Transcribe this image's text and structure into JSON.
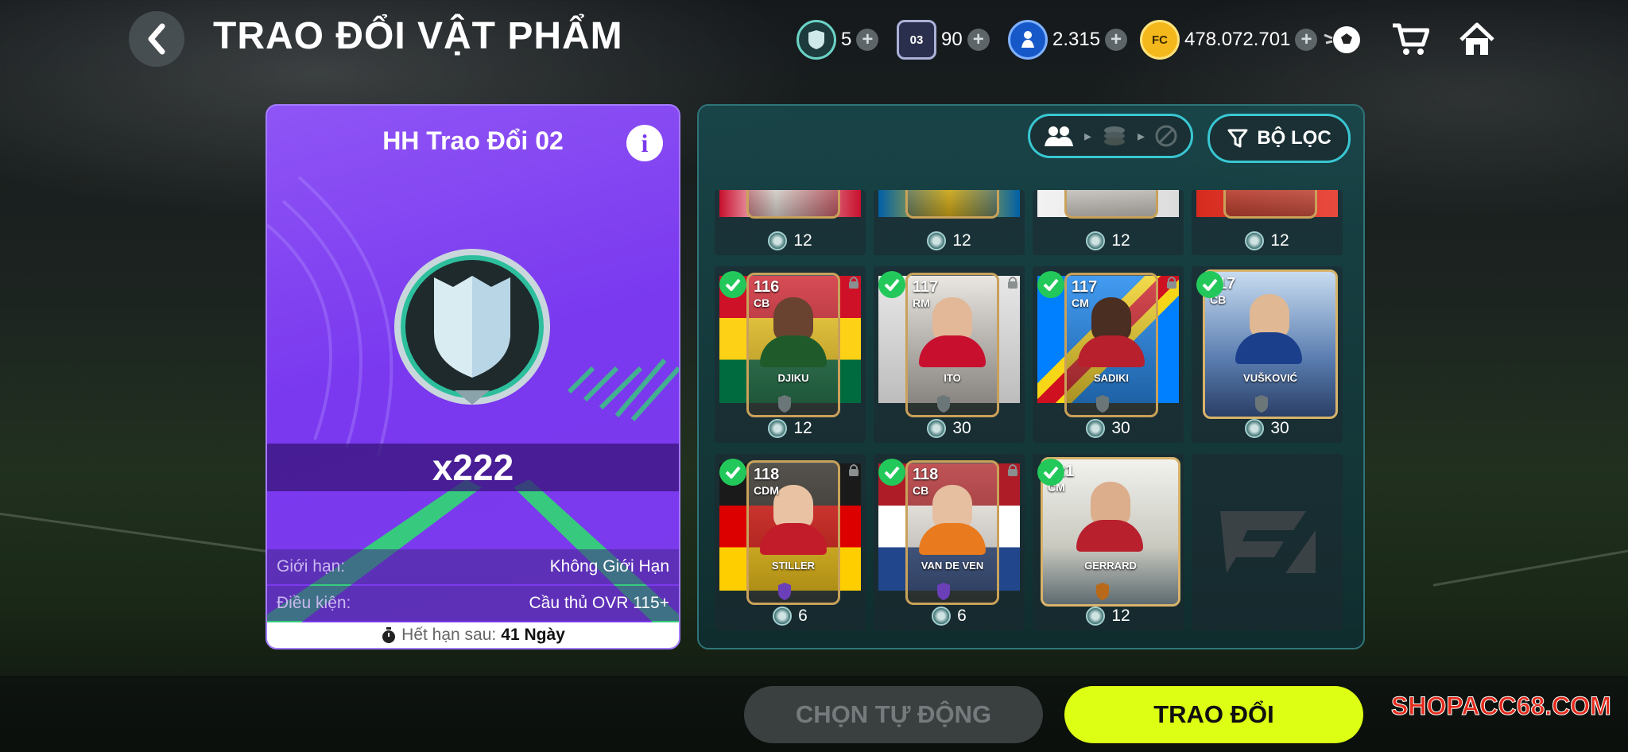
{
  "header": {
    "title": "TRAO ĐỔI VẬT PHẨM",
    "currencies": [
      {
        "icon": "shield-token-icon",
        "value": "5"
      },
      {
        "icon": "pack-03-icon",
        "value": "90",
        "badge": "03"
      },
      {
        "icon": "player-token-icon",
        "value": "2.315"
      },
      {
        "icon": "fc-coin-icon",
        "value": "478.072.701"
      }
    ]
  },
  "item_card": {
    "title": "HH Trao Đổi 02",
    "quantity": "x222",
    "limit_label": "Giới hạn:",
    "limit_value": "Không Giới Hạn",
    "condition_label": "Điều kiện:",
    "condition_value": "Cầu thủ OVR 115+",
    "expire_label": "Hết hạn sau:",
    "expire_value": "41 Ngày"
  },
  "filters": {
    "filter_label": "BỘ LỌC"
  },
  "players_top_row": [
    {
      "cost": "12"
    },
    {
      "cost": "12"
    },
    {
      "cost": "12"
    },
    {
      "cost": "12"
    }
  ],
  "players": [
    {
      "ovr": "116",
      "pos": "CB",
      "name": "DJIKU",
      "cost": "12",
      "selected": true
    },
    {
      "ovr": "117",
      "pos": "RM",
      "name": "ITO",
      "cost": "30",
      "selected": true
    },
    {
      "ovr": "117",
      "pos": "CM",
      "name": "SADIKI",
      "cost": "30",
      "selected": true
    },
    {
      "ovr": "117",
      "pos": "CB",
      "name": "VUŠKOVIĆ",
      "cost": "30",
      "selected": true
    },
    {
      "ovr": "118",
      "pos": "CDM",
      "name": "STILLER",
      "cost": "6",
      "selected": true
    },
    {
      "ovr": "118",
      "pos": "CB",
      "name": "VAN DE VEN",
      "cost": "6",
      "selected": true
    },
    {
      "ovr": "121",
      "pos": "CM",
      "name": "GERRARD",
      "cost": "12",
      "selected": true
    }
  ],
  "buttons": {
    "auto_select": "CHỌN TỰ ĐỘNG",
    "trade": "TRAO ĐỔI"
  },
  "watermark": "SHOPACC68.COM",
  "colors": {
    "card_purple": "#7b3aef",
    "trade_button": "#dcff14",
    "panel_teal": "#184a4e",
    "check_green": "#23c85a"
  }
}
